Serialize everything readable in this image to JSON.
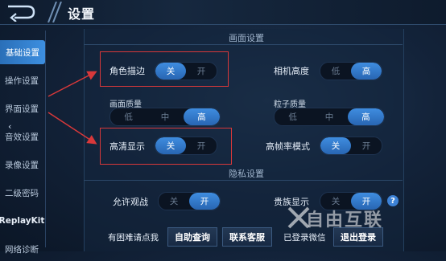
{
  "header": {
    "title": "设置"
  },
  "sidebar": {
    "items": [
      {
        "label": "基础设置",
        "active": true
      },
      {
        "label": "操作设置"
      },
      {
        "label": "界面设置"
      },
      {
        "label": "音效设置"
      },
      {
        "label": "录像设置"
      },
      {
        "label": "二级密码"
      },
      {
        "label": "ReplayKit"
      },
      {
        "label": "网络诊断"
      }
    ]
  },
  "sections": {
    "display": "画面设置",
    "privacy": "隐私设置"
  },
  "settings": {
    "outline": {
      "label": "角色描边",
      "options": [
        "关",
        "开"
      ],
      "selected": "关"
    },
    "camera": {
      "label": "相机高度",
      "options": [
        "低",
        "高"
      ],
      "selected": "高"
    },
    "quality": {
      "label": "画面质量",
      "options": [
        "低",
        "中",
        "高"
      ],
      "selected": "高"
    },
    "particle": {
      "label": "粒子质量",
      "options": [
        "低",
        "中",
        "高"
      ],
      "selected": "高"
    },
    "hd": {
      "label": "高清显示",
      "options": [
        "关",
        "开"
      ],
      "selected": "关"
    },
    "highfps": {
      "label": "高帧率模式",
      "options": [
        "关",
        "开"
      ],
      "selected": "关"
    },
    "spectate": {
      "label": "允许观战",
      "options": [
        "关",
        "开"
      ],
      "selected": "开"
    },
    "noble": {
      "label": "贵族显示",
      "options": [
        "关",
        "开"
      ],
      "selected": "开"
    }
  },
  "help_icon": "?",
  "footer": {
    "prompt": "有困难请点我",
    "self_help": "自助查询",
    "service": "联系客服",
    "login_status": "已登录微信",
    "logout": "退出登录"
  },
  "watermark": {
    "text": "自由互联"
  },
  "colors": {
    "accent": "#3f8de0",
    "annotation": "#d8383a"
  }
}
